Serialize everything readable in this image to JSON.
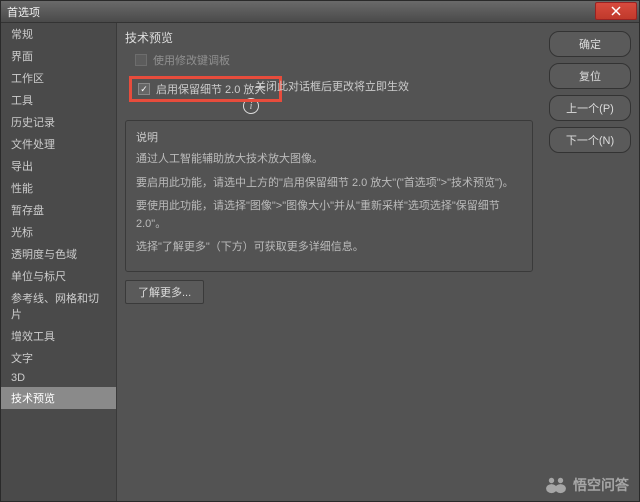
{
  "window": {
    "title": "首选项"
  },
  "sidebar": {
    "items": [
      {
        "label": "常规"
      },
      {
        "label": "界面"
      },
      {
        "label": "工作区"
      },
      {
        "label": "工具"
      },
      {
        "label": "历史记录"
      },
      {
        "label": "文件处理"
      },
      {
        "label": "导出"
      },
      {
        "label": "性能"
      },
      {
        "label": "暂存盘"
      },
      {
        "label": "光标"
      },
      {
        "label": "透明度与色域"
      },
      {
        "label": "单位与标尺"
      },
      {
        "label": "参考线、网格和切片"
      },
      {
        "label": "增效工具"
      },
      {
        "label": "文字"
      },
      {
        "label": "3D"
      },
      {
        "label": "技术预览"
      }
    ],
    "selected_index": 16
  },
  "main": {
    "section_title": "技术预览",
    "legacy_checkbox_label": "使用修改键调板",
    "feature_checkbox_label": "启用保留细节 2.0 放大",
    "feature_checkbox_checked": true,
    "note_after_checkbox": "关闭此对话框后更改将立即生效",
    "info_glyph": "i",
    "description_title": "说明",
    "description_lines": [
      "通过人工智能辅助放大技术放大图像。",
      "要启用此功能，请选中上方的\"启用保留细节 2.0 放大\"(\"首选项\">\"技术预览\")。",
      "要使用此功能，请选择\"图像\">\"图像大小\"并从\"重新采样\"选项选择\"保留细节 2.0\"。",
      "选择\"了解更多\"（下方）可获取更多详细信息。"
    ],
    "learn_more_label": "了解更多..."
  },
  "buttons": {
    "ok": "确定",
    "reset": "复位",
    "prev": "上一个(P)",
    "next": "下一个(N)"
  },
  "watermark": {
    "text": "悟空问答"
  }
}
